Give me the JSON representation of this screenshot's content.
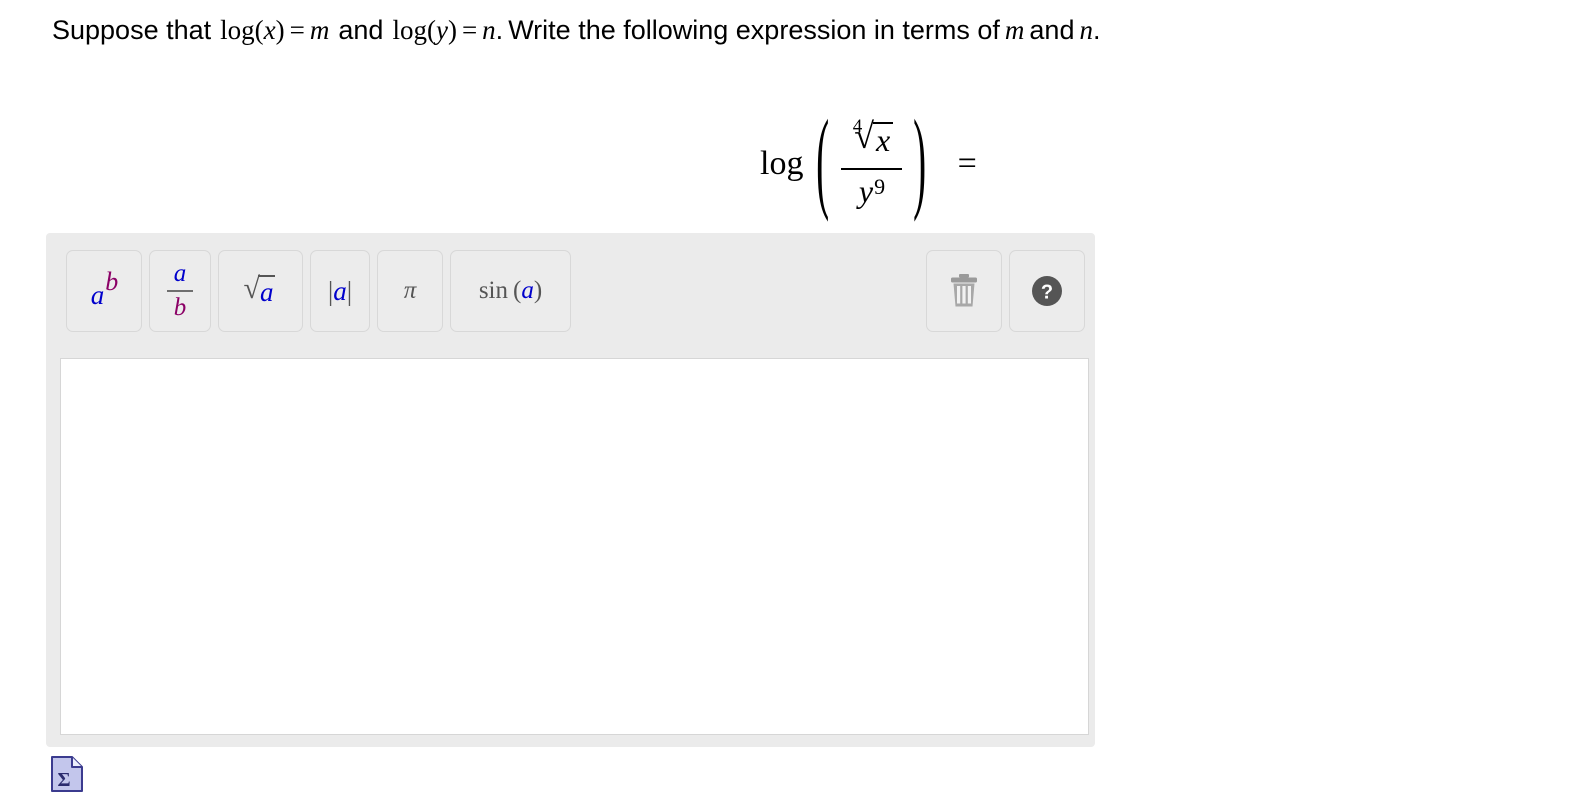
{
  "question": {
    "prefix": "Suppose that",
    "given_1": {
      "fn": "log",
      "arg": "x",
      "eq": "=",
      "value": "m"
    },
    "conjunction": "and",
    "given_2": {
      "fn": "log",
      "arg": "y",
      "eq": "=",
      "value": "n"
    },
    "instruction": "Write the following expression in terms of",
    "var_1": "m",
    "and": "and",
    "var_2": "n",
    "period": "."
  },
  "expression": {
    "operator": "log",
    "open_paren": "(",
    "close_paren": ")",
    "numerator": {
      "radical_index": "4",
      "radical_sign": "√",
      "radicand": "x"
    },
    "denominator": {
      "base": "y",
      "exponent": "9"
    },
    "equals": "="
  },
  "toolbar": {
    "buttons": [
      {
        "name": "exponent",
        "label": "a^b",
        "base": "a",
        "exponent": "b"
      },
      {
        "name": "fraction",
        "label": "a/b",
        "numerator": "a",
        "denominator": "b"
      },
      {
        "name": "square-root",
        "label": "sqrt(a)",
        "sign": "√",
        "radicand": "a"
      },
      {
        "name": "absolute-value",
        "label": "|a|",
        "bar": "|",
        "value": "a"
      },
      {
        "name": "pi",
        "label": "π",
        "symbol": "π"
      },
      {
        "name": "sine",
        "label": "sin(a)",
        "fn": "sin",
        "open": "(",
        "arg": "a",
        "close": ")"
      }
    ],
    "trash": {
      "name": "trash-icon",
      "title": "Clear"
    },
    "help": {
      "name": "help-icon",
      "title": "Help",
      "glyph": "?"
    }
  },
  "answer_input": {
    "value": "",
    "placeholder": ""
  },
  "footer": {
    "sigma_icon": {
      "name": "equation-editor-icon",
      "glyph": "Σ"
    }
  },
  "colors": {
    "panel_bg": "#ebebeb",
    "button_bg": "#ececec",
    "button_border": "#d8d8d8",
    "input_bg": "#ffffff",
    "input_border": "#d6d6d6",
    "var_blue": "#0000cc",
    "var_purple": "#8b0066",
    "operator_gray": "#555555",
    "icon_gray": "#8a8a8a",
    "sigma_fill": "#bcc0e8",
    "sigma_border": "#3b3b8f",
    "text_black": "#000000"
  }
}
